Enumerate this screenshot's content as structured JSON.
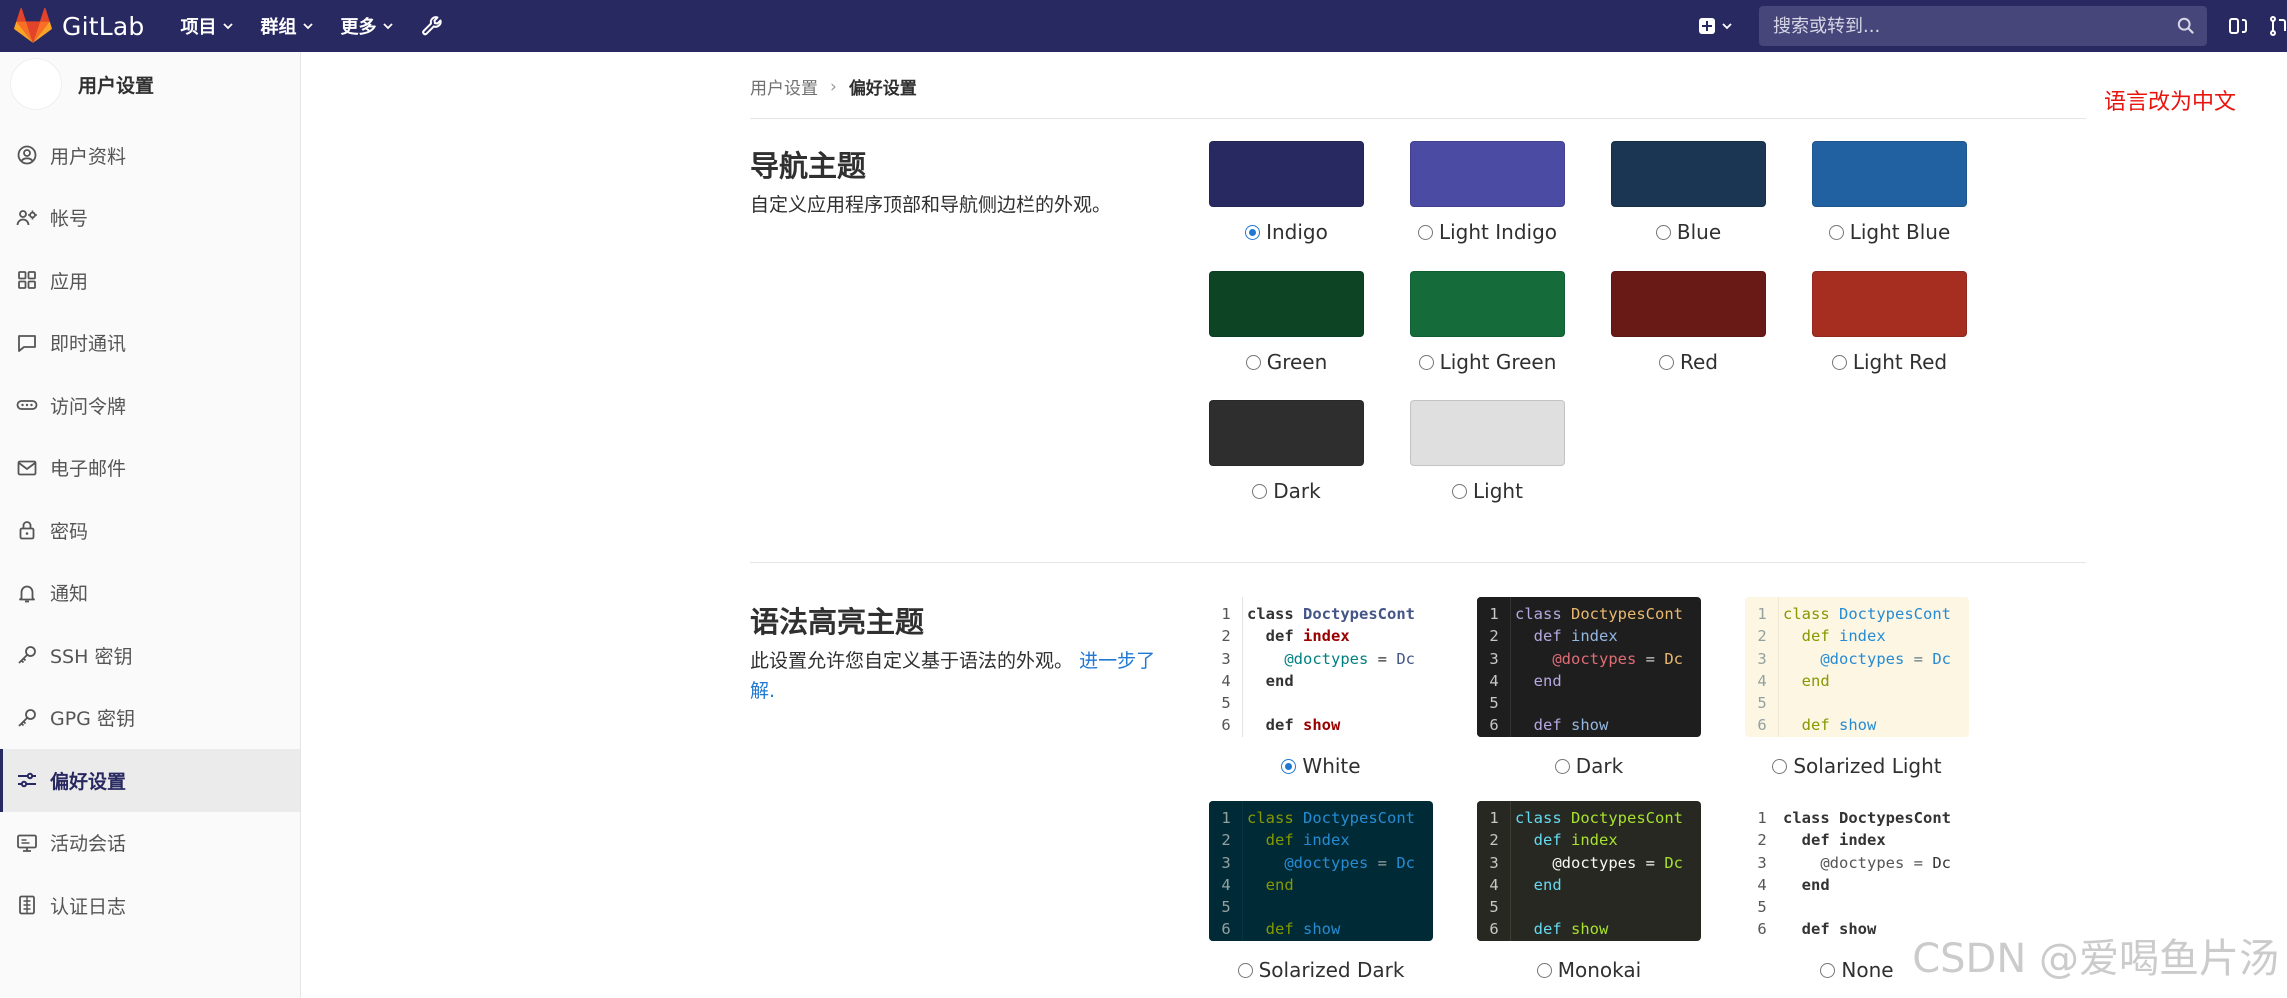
{
  "navbar": {
    "brand": "GitLab",
    "menu": [
      {
        "label": "项目"
      },
      {
        "label": "群组"
      },
      {
        "label": "更多"
      }
    ],
    "search_placeholder": "搜索或转到...",
    "bg_color": "#292961"
  },
  "sidebar": {
    "title": "用户设置",
    "items": [
      {
        "label": "用户资料",
        "icon": "profile-icon"
      },
      {
        "label": "帐号",
        "icon": "account-icon"
      },
      {
        "label": "应用",
        "icon": "applications-icon"
      },
      {
        "label": "即时通讯",
        "icon": "chat-icon"
      },
      {
        "label": "访问令牌",
        "icon": "token-icon"
      },
      {
        "label": "电子邮件",
        "icon": "mail-icon"
      },
      {
        "label": "密码",
        "icon": "lock-icon"
      },
      {
        "label": "通知",
        "icon": "bell-icon"
      },
      {
        "label": "SSH 密钥",
        "icon": "key-icon"
      },
      {
        "label": "GPG 密钥",
        "icon": "key-icon"
      },
      {
        "label": "偏好设置",
        "icon": "preferences-icon",
        "active": true
      },
      {
        "label": "活动会话",
        "icon": "monitor-icon"
      },
      {
        "label": "认证日志",
        "icon": "log-icon"
      }
    ]
  },
  "breadcrumb": {
    "parent": "用户设置",
    "current": "偏好设置"
  },
  "annotation": "语言改为中文",
  "nav_theme": {
    "title": "导航主题",
    "description": "自定义应用程序顶部和导航侧边栏的外观。",
    "themes": [
      {
        "name": "Indigo",
        "color": "#292961",
        "checked": true
      },
      {
        "name": "Light Indigo",
        "color": "#4b4ba3",
        "checked": false
      },
      {
        "name": "Blue",
        "color": "#1a3652",
        "checked": false
      },
      {
        "name": "Light Blue",
        "color": "#2261a1",
        "checked": false
      },
      {
        "name": "Green",
        "color": "#0d4524",
        "checked": false
      },
      {
        "name": "Light Green",
        "color": "#156b39",
        "checked": false
      },
      {
        "name": "Red",
        "color": "#691a16",
        "checked": false
      },
      {
        "name": "Light Red",
        "color": "#a62e21",
        "checked": false
      },
      {
        "name": "Dark",
        "color": "#2e2e2e",
        "checked": false
      },
      {
        "name": "Light",
        "color": "#dfdfdf",
        "checked": false
      }
    ]
  },
  "syntax_theme": {
    "title": "语法高亮主题",
    "description": "此设置允许您自定义基于语法的外观。",
    "link_text": "进一步了解.",
    "code_lines": [
      {
        "num": "1",
        "text": "class DoctypesCont"
      },
      {
        "num": "2",
        "text": "  def index"
      },
      {
        "num": "3",
        "text": "    @doctypes = Dc"
      },
      {
        "num": "4",
        "text": "  end"
      },
      {
        "num": "5",
        "text": ""
      },
      {
        "num": "6",
        "text": "  def show"
      }
    ],
    "themes": [
      {
        "name": "White",
        "checked": true
      },
      {
        "name": "Dark",
        "checked": false
      },
      {
        "name": "Solarized Light",
        "checked": false
      },
      {
        "name": "Solarized Dark",
        "checked": false
      },
      {
        "name": "Monokai",
        "checked": false
      },
      {
        "name": "None",
        "checked": false
      }
    ]
  },
  "watermark": "CSDN @爱喝鱼片汤"
}
